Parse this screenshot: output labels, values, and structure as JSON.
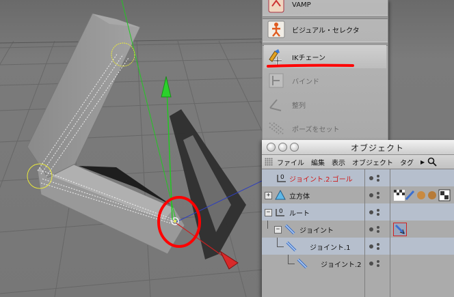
{
  "plugin_menu": {
    "items": [
      {
        "label": "VAMP",
        "icon": "vamp-icon",
        "enabled": true
      },
      {
        "label": "ビジュアル・セレクタ",
        "icon": "visual-selector-icon",
        "enabled": true
      },
      {
        "label": "IKチェーン",
        "icon": "ik-chain-icon",
        "enabled": true,
        "highlighted": true
      },
      {
        "label": "バインド",
        "icon": "bind-icon",
        "enabled": false
      },
      {
        "label": "整列",
        "icon": "align-icon",
        "enabled": false
      },
      {
        "label": "ポーズをセット",
        "icon": "set-pose-icon",
        "enabled": false
      }
    ]
  },
  "object_manager": {
    "title": "オブジェクト",
    "menu": [
      "ファイル",
      "編集",
      "表示",
      "オブジェクト",
      "タグ"
    ],
    "more_glyph": "▶",
    "rows": [
      {
        "name": "ジョイント.2.ゴール",
        "color": "#d01818",
        "selected": true
      },
      {
        "name": "立方体",
        "selected": false
      },
      {
        "name": "ルート",
        "selected": true
      },
      {
        "name": "ジョイント",
        "selected": false
      },
      {
        "name": "ジョイント.1",
        "selected": true
      },
      {
        "name": "ジョイント.2",
        "selected": false
      }
    ]
  },
  "colors": {
    "annotation": "#ff0000",
    "y_axis": "#2bd12b",
    "x_axis": "#e02020",
    "selected_row": "#b6bfcd"
  }
}
